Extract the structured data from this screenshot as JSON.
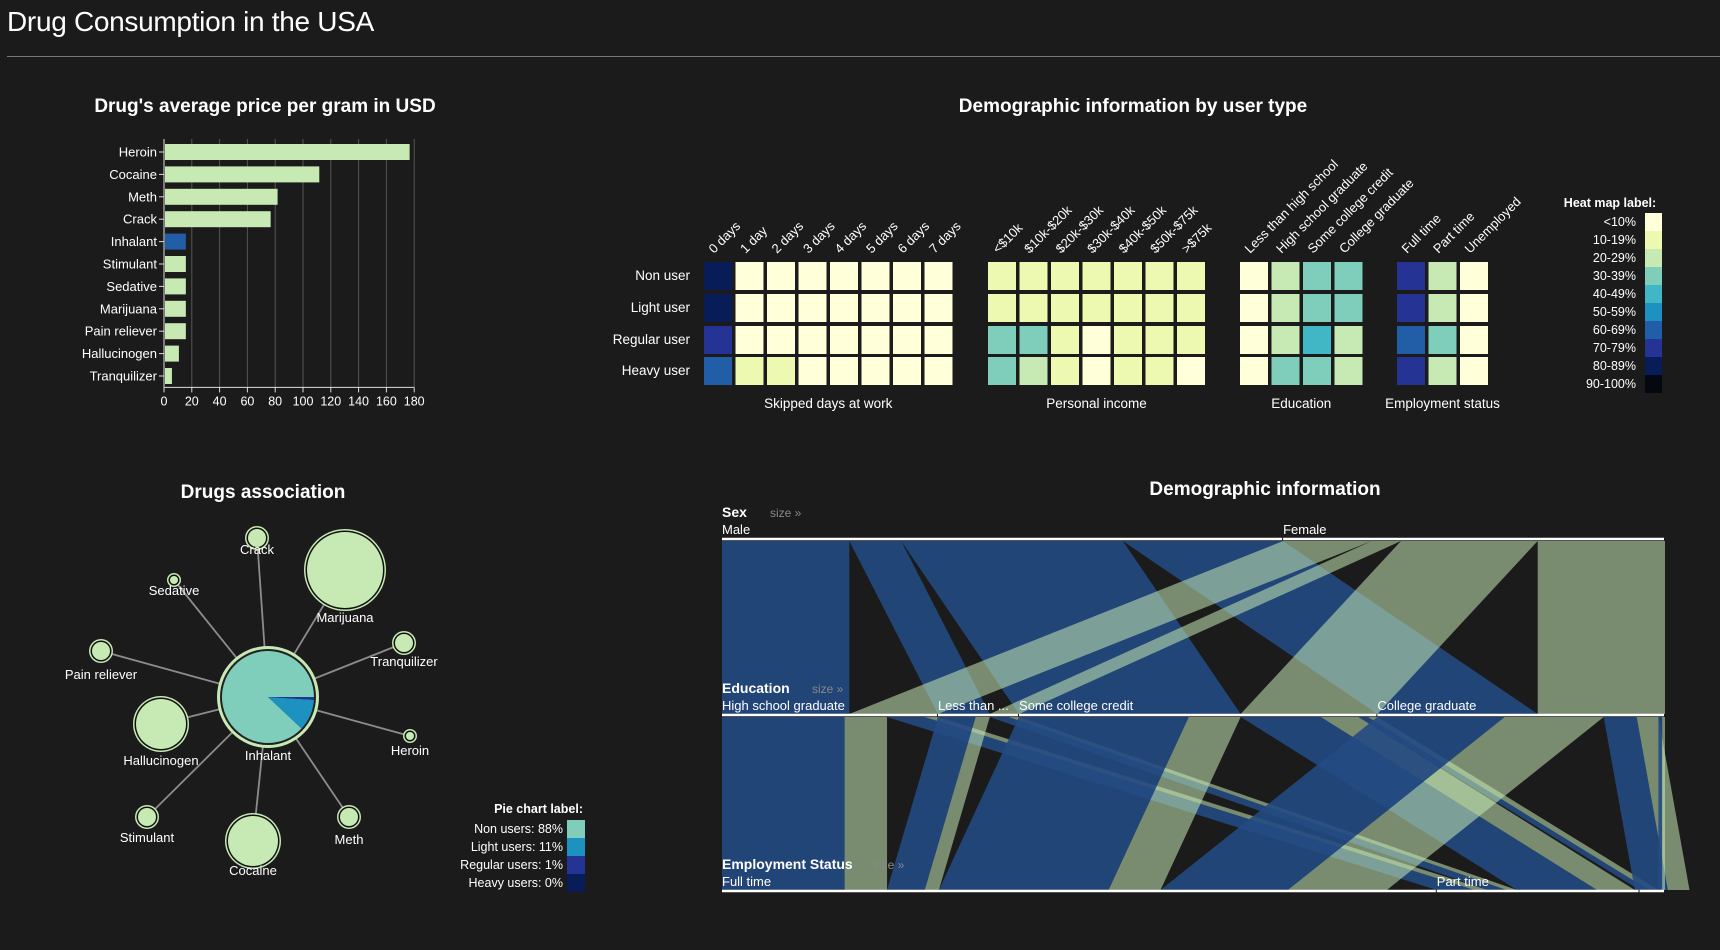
{
  "app": {
    "title": "Drug Consumption in the USA"
  },
  "colors": {
    "background": "#1b1b1b",
    "bar_default": "#c7e9b4",
    "bar_selected": "#225ea8",
    "heat_scale": [
      "#ffffd9",
      "#edf8b1",
      "#c7e9b4",
      "#7fcdbb",
      "#41b6c4",
      "#1d91c0",
      "#225ea8",
      "#253494",
      "#081d58",
      "#040810"
    ],
    "parallel_male": "#234a82",
    "parallel_female": "#c7e9b4"
  },
  "price_chart": {
    "title": "Drug's average price per gram in USD",
    "chart_data": {
      "type": "bar",
      "orientation": "horizontal",
      "categories": [
        "Heroin",
        "Cocaine",
        "Meth",
        "Crack",
        "Inhalant",
        "Stimulant",
        "Sedative",
        "Marijuana",
        "Pain reliever",
        "Hallucinogen",
        "Tranquilizer"
      ],
      "values": [
        176,
        111,
        81,
        76,
        15,
        15,
        15,
        15,
        15,
        10,
        5
      ],
      "selected": "Inhalant",
      "xlim": [
        0,
        180
      ],
      "xticks": [
        "0",
        "20",
        "40",
        "60",
        "80",
        "100",
        "120",
        "140",
        "160",
        "180"
      ],
      "grid": true,
      "xlabel": "",
      "ylabel": ""
    }
  },
  "heatmap": {
    "title": "Demographic information by user type",
    "rows": [
      "Non user",
      "Light user",
      "Regular user",
      "Heavy user"
    ],
    "groups": [
      {
        "label": "Skipped days at work",
        "columns": [
          "0 days",
          "1 day",
          "2 days",
          "3 days",
          "4 days",
          "5 days",
          "6 days",
          "7 days"
        ],
        "levels": [
          [
            8,
            0,
            0,
            0,
            0,
            0,
            0,
            0
          ],
          [
            8,
            0,
            0,
            0,
            0,
            0,
            0,
            0
          ],
          [
            7,
            0,
            0,
            0,
            0,
            0,
            0,
            0
          ],
          [
            6,
            1,
            1,
            0,
            0,
            0,
            0,
            0
          ]
        ]
      },
      {
        "label": "Personal income",
        "columns": [
          "<$10k",
          "$10k-$20k",
          "$20k-$30k",
          "$30k-$40k",
          "$40k-$50k",
          "$50k-$75k",
          ">$75k"
        ],
        "levels": [
          [
            1,
            1,
            1,
            1,
            1,
            1,
            1
          ],
          [
            1,
            1,
            1,
            1,
            1,
            1,
            1
          ],
          [
            3,
            3,
            1,
            0,
            1,
            1,
            1
          ],
          [
            3,
            2,
            1,
            0,
            1,
            1,
            0
          ]
        ]
      },
      {
        "label": "Education",
        "columns": [
          "Less than high school",
          "High school graduate",
          "Some college credit",
          "College graduate"
        ],
        "levels": [
          [
            0,
            2,
            3,
            3
          ],
          [
            0,
            2,
            3,
            3
          ],
          [
            0,
            2,
            4,
            2
          ],
          [
            0,
            3,
            3,
            2
          ]
        ]
      },
      {
        "label": "Employment status",
        "columns": [
          "Full time",
          "Part time",
          "Unemployed"
        ],
        "levels": [
          [
            7,
            2,
            0
          ],
          [
            7,
            2,
            0
          ],
          [
            6,
            3,
            0
          ],
          [
            7,
            2,
            0
          ]
        ]
      }
    ],
    "legend": {
      "title": "Heat map label:",
      "labels": [
        "<10%",
        "10-19%",
        "20-29%",
        "30-39%",
        "40-49%",
        "50-59%",
        "60-69%",
        "70-79%",
        "80-89%",
        "90-100%"
      ]
    }
  },
  "association": {
    "title": "Drugs association",
    "center": {
      "label": "Inhalant",
      "pie": [
        88,
        11,
        1,
        0
      ]
    },
    "nodes": [
      {
        "label": "Marijuana",
        "size": 3
      },
      {
        "label": "Tranquilizer",
        "size": 1
      },
      {
        "label": "Heroin",
        "size": 0
      },
      {
        "label": "Meth",
        "size": 1
      },
      {
        "label": "Cocaine",
        "size": 2
      },
      {
        "label": "Stimulant",
        "size": 1
      },
      {
        "label": "Hallucinogen",
        "size": 2
      },
      {
        "label": "Pain reliever",
        "size": 1
      },
      {
        "label": "Sedative",
        "size": 0
      },
      {
        "label": "Crack",
        "size": 1
      }
    ],
    "legend": {
      "title": "Pie chart label:",
      "items": [
        "Non users: 88%",
        "Light users: 11%",
        "Regular users: 1%",
        "Heavy users: 0%"
      ]
    }
  },
  "parallel_sets": {
    "title": "Demographic information",
    "size_link": "size »",
    "dimensions": [
      {
        "name": "Sex",
        "categories": [
          {
            "label": "Male",
            "frac": 0.595
          },
          {
            "label": "Female",
            "frac": 0.405
          }
        ]
      },
      {
        "name": "Education",
        "categories": [
          {
            "label": "High school graduate",
            "frac": 0.229
          },
          {
            "label": "Less than ...",
            "frac": 0.086
          },
          {
            "label": "Some college credit",
            "frac": 0.38
          },
          {
            "label": "College graduate",
            "frac": 0.305
          }
        ]
      },
      {
        "name": "Employment Status",
        "categories": [
          {
            "label": "Full time",
            "frac": 0.758
          },
          {
            "label": "Part time",
            "frac": 0.215
          },
          {
            "label": "",
            "frac": 0.027
          }
        ]
      }
    ],
    "ribbons_sex_edu": [
      [
        0,
        0,
        0.135
      ],
      [
        0,
        1,
        0.055
      ],
      [
        0,
        2,
        0.235
      ],
      [
        0,
        3,
        0.17
      ],
      [
        1,
        0,
        0.094
      ],
      [
        1,
        1,
        0.031
      ],
      [
        1,
        2,
        0.145
      ],
      [
        1,
        3,
        0.135
      ]
    ],
    "ribbons_edu_emp": [
      [
        0,
        0,
        0.13,
        0
      ],
      [
        0,
        0,
        0.045,
        1
      ],
      [
        0,
        1,
        0.04,
        0
      ],
      [
        0,
        1,
        0.014,
        1
      ],
      [
        1,
        0,
        0.04,
        0
      ],
      [
        1,
        0,
        0.015,
        1
      ],
      [
        1,
        1,
        0.02,
        0
      ],
      [
        1,
        1,
        0.011,
        1
      ],
      [
        2,
        0,
        0.18,
        0
      ],
      [
        2,
        0,
        0.055,
        1
      ],
      [
        2,
        1,
        0.085,
        0
      ],
      [
        2,
        1,
        0.04,
        1
      ],
      [
        2,
        2,
        0.01,
        0
      ],
      [
        2,
        2,
        0.01,
        1
      ],
      [
        3,
        0,
        0.135,
        0
      ],
      [
        3,
        0,
        0.105,
        1
      ],
      [
        3,
        1,
        0.035,
        0
      ],
      [
        3,
        1,
        0.023,
        1
      ],
      [
        3,
        2,
        0.004,
        0
      ],
      [
        3,
        2,
        0.003,
        1
      ]
    ]
  }
}
